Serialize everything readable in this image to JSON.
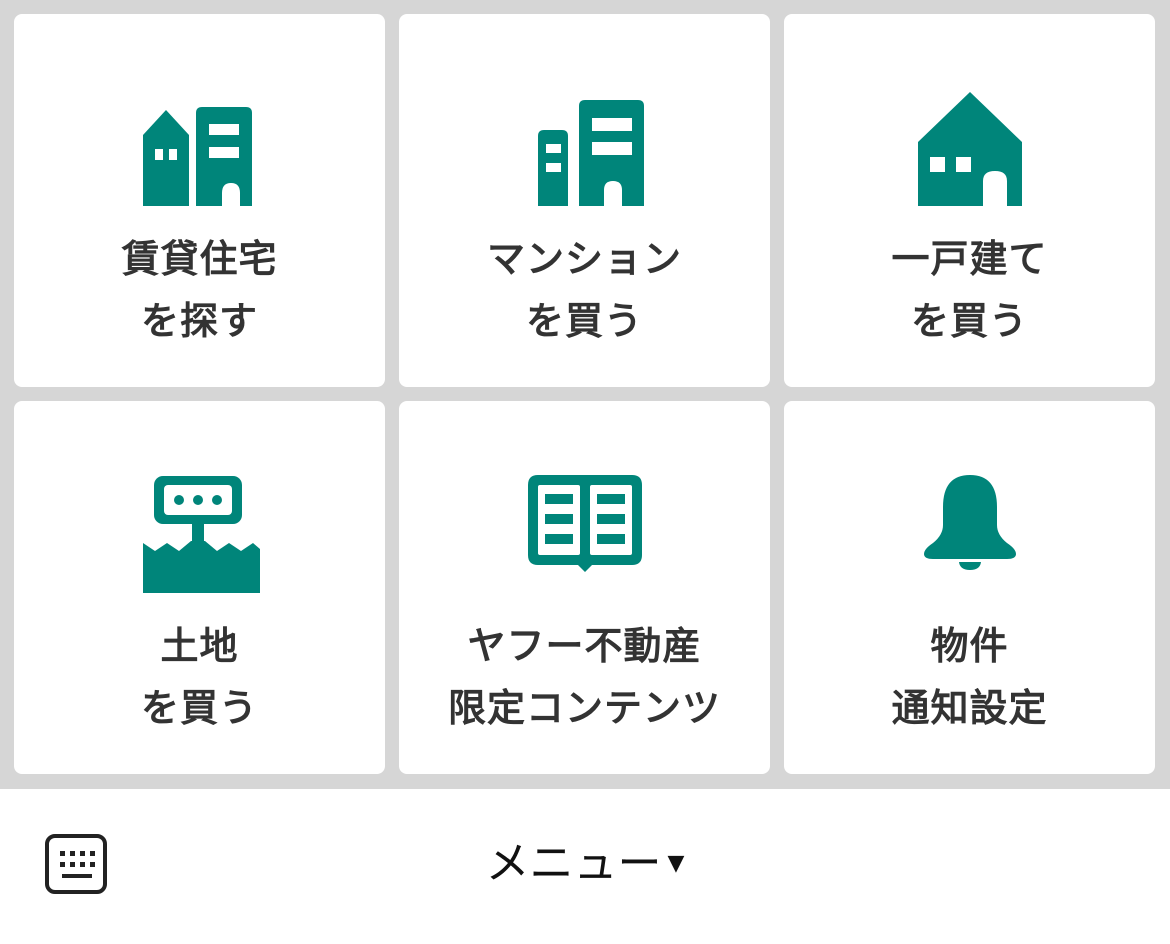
{
  "colors": {
    "accent": "#00857A",
    "tile_background": "#FFFFFF",
    "grid_background": "#D6D6D6",
    "label_text": "#333333"
  },
  "tiles": [
    {
      "icon": "rental-buildings-icon",
      "line1": "賃貸住宅",
      "line2": "を探す"
    },
    {
      "icon": "apartment-building-icon",
      "line1": "マンション",
      "line2": "を買う"
    },
    {
      "icon": "house-icon",
      "line1": "一戸建て",
      "line2": "を買う"
    },
    {
      "icon": "land-sign-icon",
      "line1": "土地",
      "line2": "を買う"
    },
    {
      "icon": "open-book-icon",
      "line1": "ヤフー不動産",
      "line2": "限定コンテンツ"
    },
    {
      "icon": "bell-icon",
      "line1": "物件",
      "line2": "通知設定"
    }
  ],
  "bottom_bar": {
    "keyboard_icon": "keyboard-icon",
    "menu_label": "メニュー",
    "menu_caret": "▼",
    "caret_icon": "caret-down-icon"
  }
}
